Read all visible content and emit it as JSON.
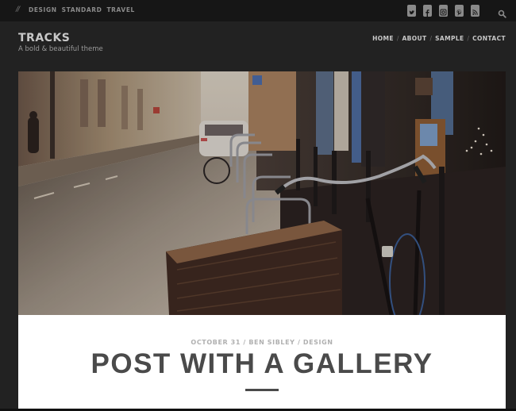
{
  "topbar": {
    "slashes": "//",
    "categories": [
      "DESIGN",
      "STANDARD",
      "TRAVEL"
    ],
    "social_icons": [
      "twitter-icon",
      "facebook-icon",
      "instagram-icon",
      "pinterest-icon",
      "rss-icon"
    ],
    "search_icon": "search-icon"
  },
  "header": {
    "site_title": "TRACKS",
    "tagline": "A bold & beautiful theme",
    "nav": [
      "HOME",
      "ABOUT",
      "SAMPLE",
      "CONTACT"
    ],
    "nav_separator": "/"
  },
  "post": {
    "featured_image_alt": "Bicycle with wicker basket parked on a misty city street",
    "meta": {
      "date": "OCTOBER 31",
      "author": "BEN SIBLEY",
      "category": "DESIGN",
      "separator": "/"
    },
    "title": "POST WITH A GALLERY"
  },
  "colors": {
    "topbar_bg": "#161616",
    "header_bg": "#222222",
    "card_bg": "#ffffff",
    "title_text": "#4a4a4a",
    "meta_text": "#b0b0b0"
  }
}
